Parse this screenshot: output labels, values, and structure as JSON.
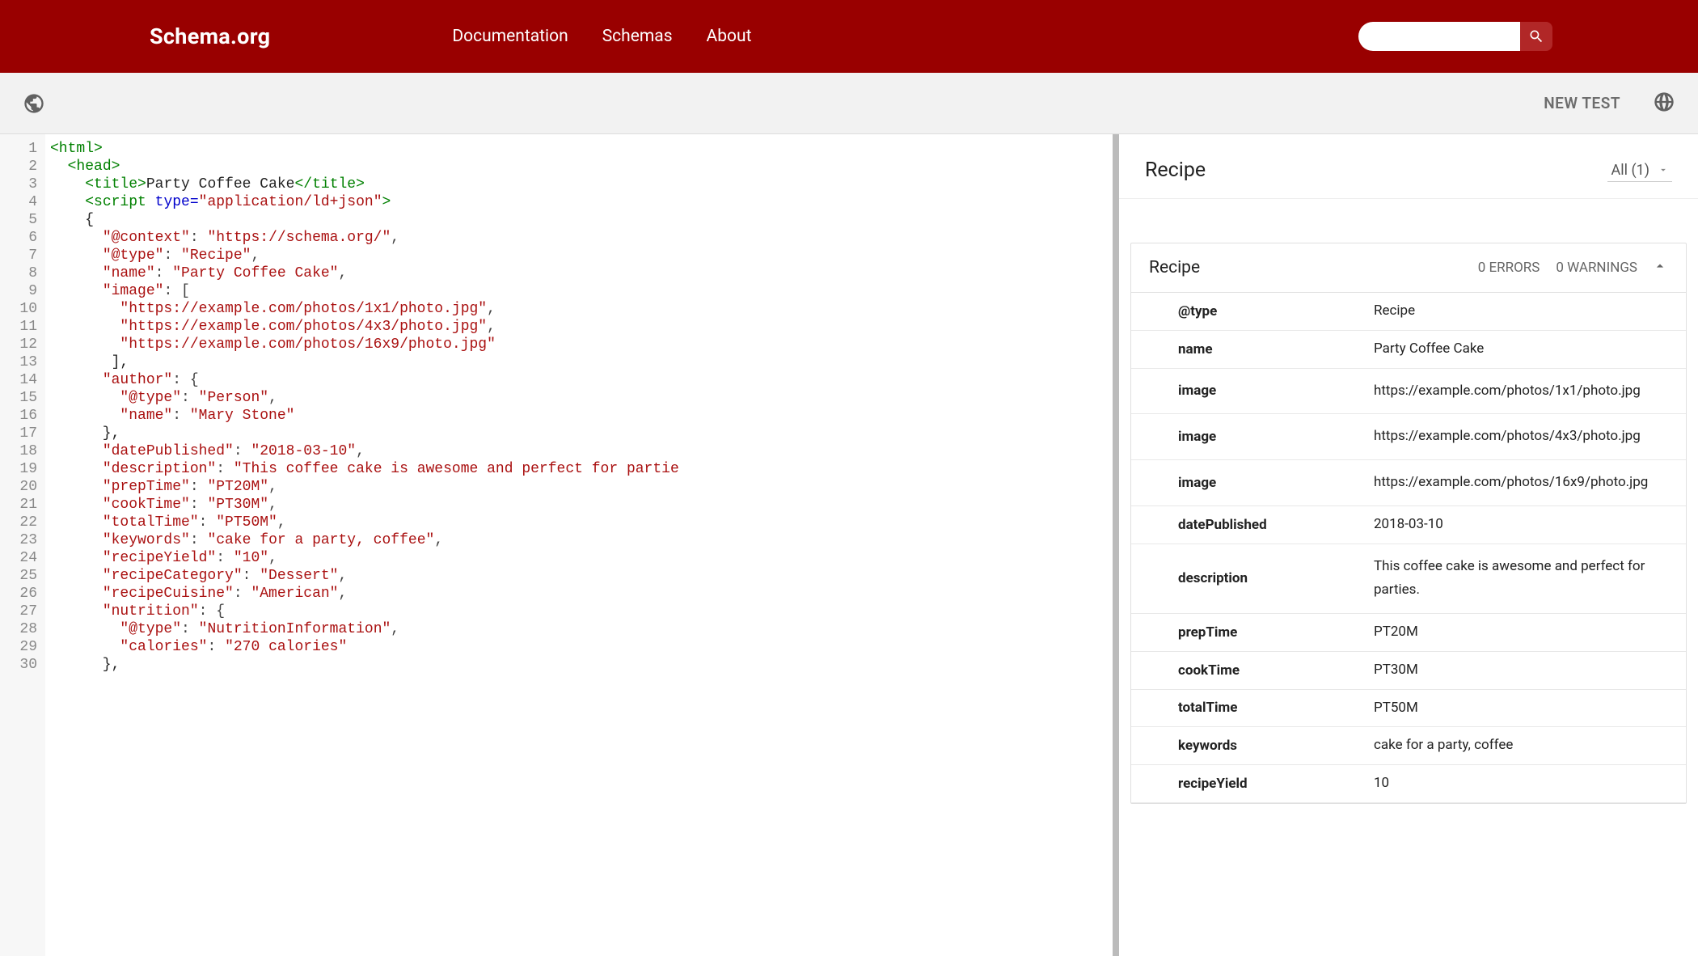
{
  "header": {
    "logo": "Schema.org",
    "nav": [
      "Documentation",
      "Schemas",
      "About"
    ],
    "searchPlaceholder": ""
  },
  "toolbar": {
    "newTest": "NEW TEST"
  },
  "code": {
    "lines": 30,
    "tokens": [
      [
        [
          "tag",
          "<html>"
        ]
      ],
      [
        [
          "",
          "  "
        ],
        [
          "tag",
          "<head>"
        ]
      ],
      [
        [
          "",
          "    "
        ],
        [
          "tag",
          "<title>"
        ],
        [
          "",
          "Party Coffee Cake"
        ],
        [
          "tag",
          "</title>"
        ]
      ],
      [
        [
          "",
          "    "
        ],
        [
          "tag",
          "<script "
        ],
        [
          "attr",
          "type="
        ],
        [
          "str",
          "\"application/ld+json\""
        ],
        [
          "tag",
          ">"
        ]
      ],
      [
        [
          "",
          "    {"
        ]
      ],
      [
        [
          "",
          "      "
        ],
        [
          "str",
          "\"@context\""
        ],
        [
          "punc",
          ": "
        ],
        [
          "str",
          "\"https://schema.org/\""
        ],
        [
          "punc",
          ","
        ]
      ],
      [
        [
          "",
          "      "
        ],
        [
          "str",
          "\"@type\""
        ],
        [
          "punc",
          ": "
        ],
        [
          "str",
          "\"Recipe\""
        ],
        [
          "punc",
          ","
        ]
      ],
      [
        [
          "",
          "      "
        ],
        [
          "str",
          "\"name\""
        ],
        [
          "punc",
          ": "
        ],
        [
          "str",
          "\"Party Coffee Cake\""
        ],
        [
          "punc",
          ","
        ]
      ],
      [
        [
          "",
          "      "
        ],
        [
          "str",
          "\"image\""
        ],
        [
          "punc",
          ": ["
        ]
      ],
      [
        [
          "",
          "        "
        ],
        [
          "str",
          "\"https://example.com/photos/1x1/photo.jpg\""
        ],
        [
          "punc",
          ","
        ]
      ],
      [
        [
          "",
          "        "
        ],
        [
          "str",
          "\"https://example.com/photos/4x3/photo.jpg\""
        ],
        [
          "punc",
          ","
        ]
      ],
      [
        [
          "",
          "        "
        ],
        [
          "str",
          "\"https://example.com/photos/16x9/photo.jpg\""
        ]
      ],
      [
        [
          "",
          "       ],"
        ]
      ],
      [
        [
          "",
          "      "
        ],
        [
          "str",
          "\"author\""
        ],
        [
          "punc",
          ": {"
        ]
      ],
      [
        [
          "",
          "        "
        ],
        [
          "str",
          "\"@type\""
        ],
        [
          "punc",
          ": "
        ],
        [
          "str",
          "\"Person\""
        ],
        [
          "punc",
          ","
        ]
      ],
      [
        [
          "",
          "        "
        ],
        [
          "str",
          "\"name\""
        ],
        [
          "punc",
          ": "
        ],
        [
          "str",
          "\"Mary Stone\""
        ]
      ],
      [
        [
          "",
          "      },"
        ]
      ],
      [
        [
          "",
          "      "
        ],
        [
          "str",
          "\"datePublished\""
        ],
        [
          "punc",
          ": "
        ],
        [
          "str",
          "\"2018-03-10\""
        ],
        [
          "punc",
          ","
        ]
      ],
      [
        [
          "",
          "      "
        ],
        [
          "str",
          "\"description\""
        ],
        [
          "punc",
          ": "
        ],
        [
          "str",
          "\"This coffee cake is awesome and perfect for partie"
        ]
      ],
      [
        [
          "",
          "      "
        ],
        [
          "str",
          "\"prepTime\""
        ],
        [
          "punc",
          ": "
        ],
        [
          "str",
          "\"PT20M\""
        ],
        [
          "punc",
          ","
        ]
      ],
      [
        [
          "",
          "      "
        ],
        [
          "str",
          "\"cookTime\""
        ],
        [
          "punc",
          ": "
        ],
        [
          "str",
          "\"PT30M\""
        ],
        [
          "punc",
          ","
        ]
      ],
      [
        [
          "",
          "      "
        ],
        [
          "str",
          "\"totalTime\""
        ],
        [
          "punc",
          ": "
        ],
        [
          "str",
          "\"PT50M\""
        ],
        [
          "punc",
          ","
        ]
      ],
      [
        [
          "",
          "      "
        ],
        [
          "str",
          "\"keywords\""
        ],
        [
          "punc",
          ": "
        ],
        [
          "str",
          "\"cake for a party, coffee\""
        ],
        [
          "punc",
          ","
        ]
      ],
      [
        [
          "",
          "      "
        ],
        [
          "str",
          "\"recipeYield\""
        ],
        [
          "punc",
          ": "
        ],
        [
          "str",
          "\"10\""
        ],
        [
          "punc",
          ","
        ]
      ],
      [
        [
          "",
          "      "
        ],
        [
          "str",
          "\"recipeCategory\""
        ],
        [
          "punc",
          ": "
        ],
        [
          "str",
          "\"Dessert\""
        ],
        [
          "punc",
          ","
        ]
      ],
      [
        [
          "",
          "      "
        ],
        [
          "str",
          "\"recipeCuisine\""
        ],
        [
          "punc",
          ": "
        ],
        [
          "str",
          "\"American\""
        ],
        [
          "punc",
          ","
        ]
      ],
      [
        [
          "",
          "      "
        ],
        [
          "str",
          "\"nutrition\""
        ],
        [
          "punc",
          ": {"
        ]
      ],
      [
        [
          "",
          "        "
        ],
        [
          "str",
          "\"@type\""
        ],
        [
          "punc",
          ": "
        ],
        [
          "str",
          "\"NutritionInformation\""
        ],
        [
          "punc",
          ","
        ]
      ],
      [
        [
          "",
          "        "
        ],
        [
          "str",
          "\"calories\""
        ],
        [
          "punc",
          ": "
        ],
        [
          "str",
          "\"270 calories\""
        ]
      ],
      [
        [
          "",
          "      },"
        ]
      ]
    ]
  },
  "results": {
    "heading": "Recipe",
    "filter": "All (1)",
    "card": {
      "title": "Recipe",
      "errors": "0 ERRORS",
      "warnings": "0 WARNINGS",
      "props": [
        {
          "k": "@type",
          "v": "Recipe"
        },
        {
          "k": "name",
          "v": "Party Coffee Cake"
        },
        {
          "k": "image",
          "v": "https://example.com/photos/1x1/photo.jpg",
          "tall": true
        },
        {
          "k": "image",
          "v": "https://example.com/photos/4x3/photo.jpg",
          "tall": true
        },
        {
          "k": "image",
          "v": "https://example.com/photos/16x9/photo.jpg",
          "tall": true
        },
        {
          "k": "datePublished",
          "v": "2018-03-10"
        },
        {
          "k": "description",
          "v": "This coffee cake is awesome and perfect for parties.",
          "tall": true
        },
        {
          "k": "prepTime",
          "v": "PT20M"
        },
        {
          "k": "cookTime",
          "v": "PT30M"
        },
        {
          "k": "totalTime",
          "v": "PT50M"
        },
        {
          "k": "keywords",
          "v": "cake for a party, coffee"
        },
        {
          "k": "recipeYield",
          "v": "10"
        }
      ]
    }
  }
}
